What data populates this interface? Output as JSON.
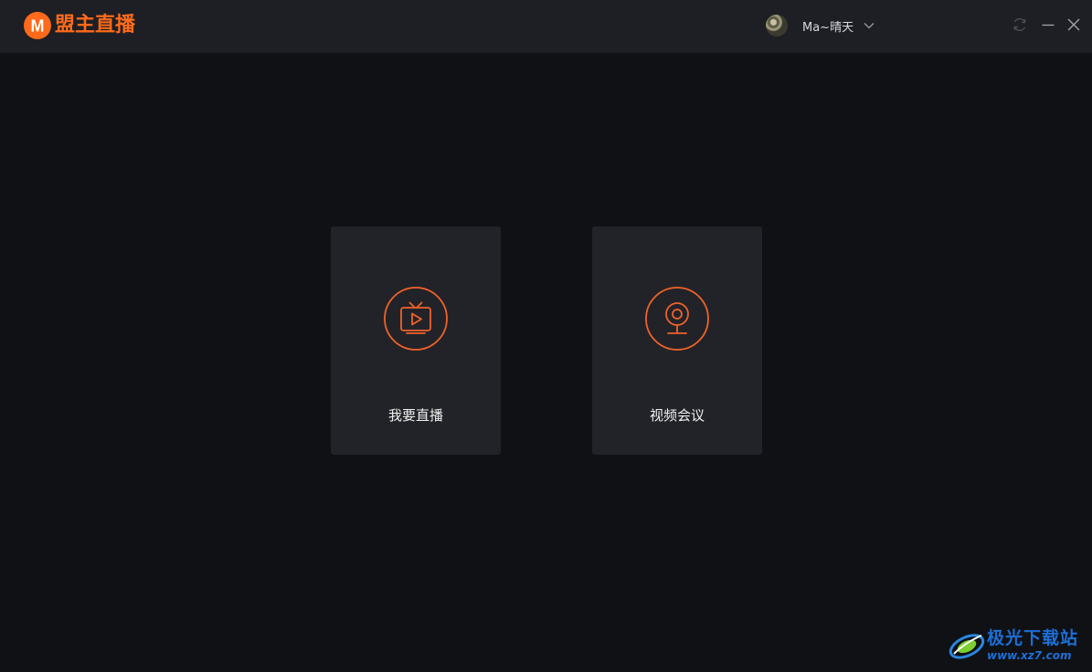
{
  "app": {
    "logo_letter": "M",
    "logo_text": "盟主直播",
    "accent_color": "#ff6a1a"
  },
  "header": {
    "username": "Ma~晴天"
  },
  "cards": [
    {
      "label": "我要直播",
      "icon": "tv-play-icon"
    },
    {
      "label": "视频会议",
      "icon": "webcam-icon"
    }
  ],
  "watermark": {
    "title": "极光下载站",
    "url": "www.xz7.com"
  }
}
